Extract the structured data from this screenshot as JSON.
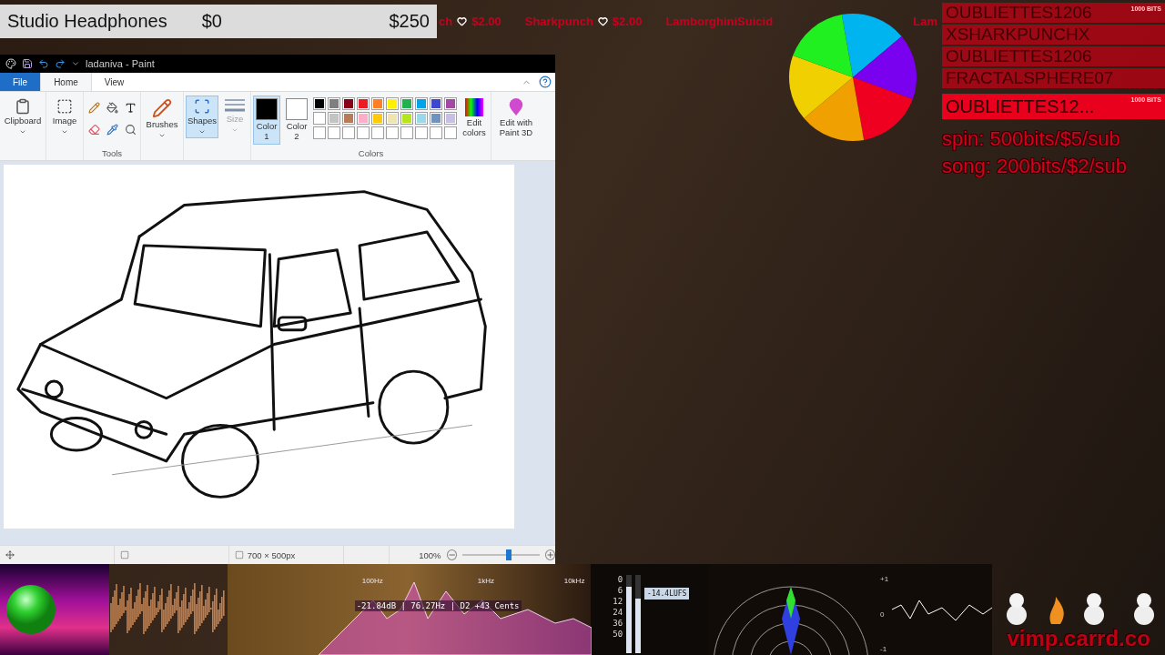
{
  "goal": {
    "name": "Studio Headphones",
    "current": "$0",
    "target": "$250",
    "level": 0
  },
  "ticker": [
    {
      "name": "ch",
      "amount": "$2.00"
    },
    {
      "name": "Sharkpunch",
      "amount": "$2.00"
    },
    {
      "name": "LamborghiniSuicid"
    },
    {
      "name": "Lam"
    }
  ],
  "paint": {
    "title": "ladaniva - Paint",
    "tabs": [
      {
        "label": "File",
        "kind": "file",
        "selected": false
      },
      {
        "label": "Home",
        "kind": "tab",
        "selected": true
      },
      {
        "label": "View",
        "kind": "tab",
        "selected": false
      }
    ],
    "clipboard": "Clipboard",
    "image": "Image",
    "tools": "Tools",
    "brushes": "Brushes",
    "shapes": "Shapes",
    "size": {
      "label": "Size",
      "disabled": true
    },
    "color1": {
      "label": "Color 1",
      "selected": true,
      "color": "#000000"
    },
    "color2": {
      "label": "Color 2",
      "selected": false,
      "color": "#ffffff"
    },
    "palette": [
      {
        "color": "#000000"
      },
      {
        "color": "#7f7f7f"
      },
      {
        "color": "#880015"
      },
      {
        "color": "#ed1c24"
      },
      {
        "color": "#ff7f27"
      },
      {
        "color": "#fff200"
      },
      {
        "color": "#22b14c"
      },
      {
        "color": "#00a2e8"
      },
      {
        "color": "#3f48cc"
      },
      {
        "color": "#a349a4"
      },
      {
        "color": "#ffffff"
      },
      {
        "color": "#c3c3c3"
      },
      {
        "color": "#b97a57"
      },
      {
        "color": "#ffaec9"
      },
      {
        "color": "#ffc90e"
      },
      {
        "color": "#efe4b0"
      },
      {
        "color": "#b5e61d"
      },
      {
        "color": "#99d9ea"
      },
      {
        "color": "#7092be"
      },
      {
        "color": "#c8bfe7"
      }
    ],
    "colors_label": "Colors",
    "edit_colors": "Edit colors",
    "paint3d": "Edit with Paint 3D",
    "status": {
      "dimensions": "700 × 500px",
      "zoom": "100%",
      "zoom_slider": {
        "level": 0.6
      }
    }
  },
  "events": [
    {
      "name": "OUBLIETTES1206",
      "detail": "1000 BITS",
      "latest": false
    },
    {
      "name": "XSHARKPUNCHX",
      "latest": false
    },
    {
      "name": "OUBLIETTES1206",
      "latest": false
    },
    {
      "name": "FRACTALSPHERE07",
      "latest": false
    },
    {
      "name": "OUBLIETTES12...",
      "detail": "1000 BITS",
      "latest": true
    }
  ],
  "notes": [
    "spin: 500bits/$5/sub",
    "song: 200bits/$2/sub"
  ],
  "visualizer": {
    "spectrum_labels": [
      "100Hz",
      "1kHz",
      "10kHz"
    ],
    "reading": "-21.84dB | 76.27Hz | D2  +43 Cents",
    "meter_ticks": [
      "0",
      "6",
      "12",
      "24",
      "36",
      "50"
    ],
    "meters": [
      {
        "level": 0.85
      },
      {
        "level": 0.7
      }
    ],
    "loudness": "-14.4LUFS",
    "scope_ticks": [
      "+1",
      "0",
      "-1"
    ],
    "link": "vimp.carrd.co"
  }
}
